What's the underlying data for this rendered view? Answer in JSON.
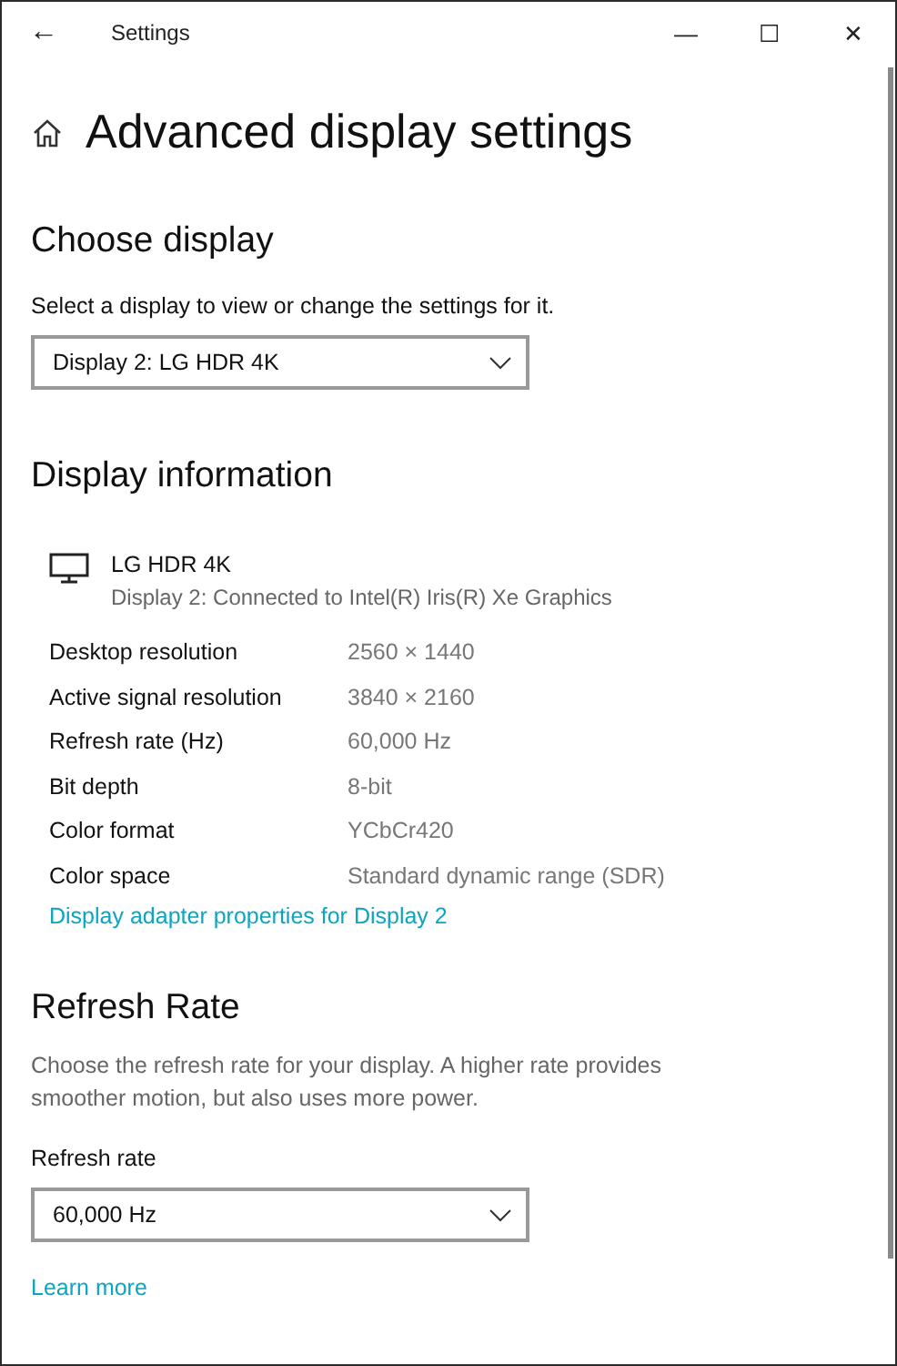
{
  "window": {
    "title": "Settings",
    "back": "←",
    "controls": [
      "—",
      "☐",
      "✕"
    ]
  },
  "page": {
    "title": "Advanced display settings"
  },
  "choose_display": {
    "heading": "Choose display",
    "label": "Select a display to view or change the settings for it.",
    "dropdown": {
      "value": "Display 2: LG HDR 4K"
    }
  },
  "display_information": {
    "heading": "Display information",
    "monitor": {
      "name": "LG HDR 4K",
      "description": "Display 2: Connected to Intel(R) Iris(R) Xe Graphics"
    },
    "rows": [
      {
        "label": "Desktop resolution",
        "value": "2560 × 1440"
      },
      {
        "label": "Active signal resolution",
        "value": "3840 × 2160"
      },
      {
        "label": "Refresh rate (Hz)",
        "value": "60,000 Hz"
      },
      {
        "label": "Bit depth",
        "value": "8-bit"
      },
      {
        "label": "Color format",
        "value": "YCbCr420"
      },
      {
        "label": "Color space",
        "value": "Standard dynamic range (SDR)"
      }
    ],
    "link": "Display adapter properties for Display 2"
  },
  "refresh_rate": {
    "heading": "Refresh Rate",
    "description": "Choose the refresh rate for your display. A higher rate provides smoother motion, but also uses more power.",
    "label": "Refresh rate",
    "dropdown": {
      "value": "60,000 Hz"
    },
    "link": "Learn more"
  }
}
